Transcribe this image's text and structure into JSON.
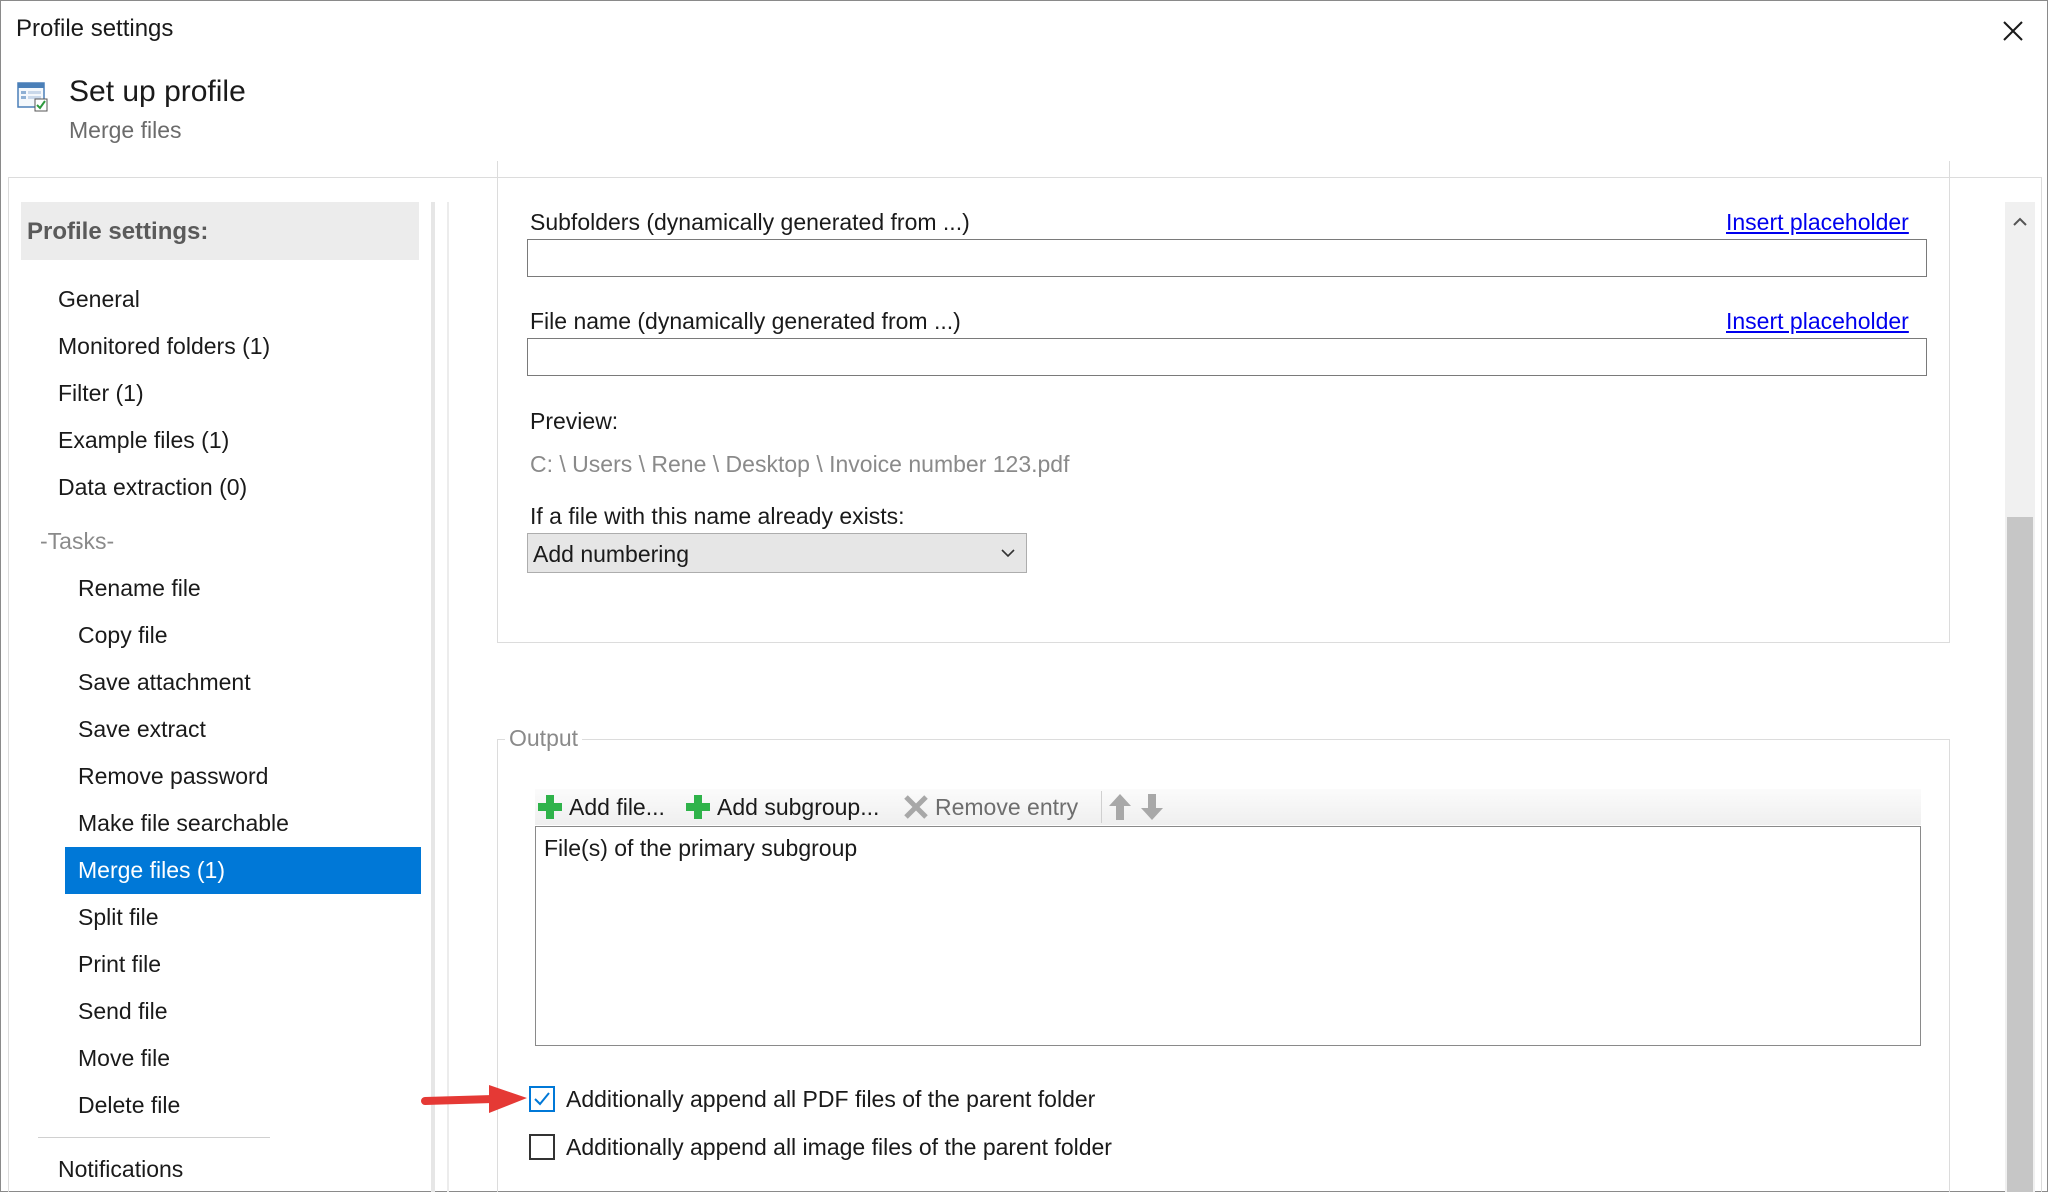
{
  "window": {
    "title": "Profile settings"
  },
  "header": {
    "title": "Set up profile",
    "subtitle": "Merge files"
  },
  "sidebar": {
    "heading": "Profile settings:",
    "items": [
      {
        "label": "General"
      },
      {
        "label": "Monitored folders (1)"
      },
      {
        "label": "Filter (1)"
      },
      {
        "label": "Example files (1)"
      },
      {
        "label": "Data extraction (0)"
      }
    ],
    "tasks_label": "-Tasks-",
    "tasks": [
      {
        "label": "Rename file"
      },
      {
        "label": "Copy file"
      },
      {
        "label": "Save attachment"
      },
      {
        "label": "Save extract"
      },
      {
        "label": "Remove password"
      },
      {
        "label": "Make file searchable"
      },
      {
        "label": "Merge files (1)",
        "selected": true
      },
      {
        "label": "Split file"
      },
      {
        "label": "Print file"
      },
      {
        "label": "Send file"
      },
      {
        "label": "Move file"
      },
      {
        "label": "Delete file"
      }
    ],
    "footer_items": [
      {
        "label": "Notifications"
      }
    ]
  },
  "main": {
    "subfolders": {
      "label": "Subfolders (dynamically generated from ...)",
      "link": "Insert placeholder",
      "value": ""
    },
    "file_name": {
      "label": "File name (dynamically generated from ...)",
      "link": "Insert placeholder",
      "value": ""
    },
    "preview": {
      "label": "Preview:",
      "value": "C: \\ Users \\ Rene \\ Desktop \\ Invoice number 123.pdf"
    },
    "exists": {
      "label": "If a file with this name already exists:",
      "selected": "Add numbering"
    },
    "output": {
      "legend": "Output",
      "toolbar": {
        "add_file": "Add file...",
        "add_subgroup": "Add subgroup...",
        "remove_entry": "Remove entry"
      },
      "list": [
        "File(s) of the primary subgroup"
      ],
      "append_pdf": {
        "label": "Additionally append all PDF files of the parent folder",
        "checked": true
      },
      "append_images": {
        "label": "Additionally append all image files of the parent folder",
        "checked": false
      }
    }
  },
  "colors": {
    "accent": "#0078d7",
    "link": "#0000ee",
    "add_icon": "#2fb34a",
    "annotation_arrow": "#e53935"
  },
  "icons": {
    "close": "close-icon",
    "profile": "profile-settings-icon",
    "add": "plus-icon",
    "remove": "x-icon",
    "move_up": "arrow-up-icon",
    "move_down": "arrow-down-icon",
    "dropdown": "chevron-down-icon",
    "scroll_up": "chevron-up-icon"
  }
}
